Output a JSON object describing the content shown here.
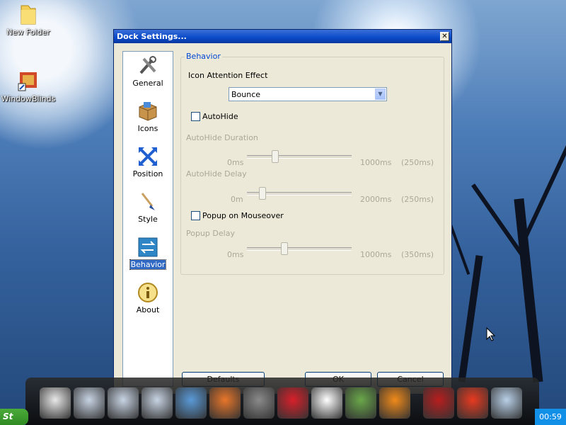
{
  "desktop": {
    "icons": [
      {
        "label": "New Folder",
        "icon": "folder-icon"
      },
      {
        "label": "WindowBlinds",
        "icon": "windowblinds-icon"
      }
    ]
  },
  "dialog": {
    "title": "Dock Settings...",
    "nav": [
      {
        "label": "General",
        "icon": "tools-icon",
        "selected": false
      },
      {
        "label": "Icons",
        "icon": "box-icon",
        "selected": false
      },
      {
        "label": "Position",
        "icon": "arrows-icon",
        "selected": false
      },
      {
        "label": "Style",
        "icon": "brush-icon",
        "selected": false
      },
      {
        "label": "Behavior",
        "icon": "behavior-icon",
        "selected": true
      },
      {
        "label": "About",
        "icon": "info-icon",
        "selected": false
      }
    ],
    "group_title": "Behavior",
    "attention_label": "Icon Attention Effect",
    "attention_value": "Bounce",
    "autohide_label": "AutoHide",
    "autohide_checked": false,
    "autohide_duration": {
      "label": "AutoHide Duration",
      "min": "0ms",
      "max": "1000ms",
      "value": "(250ms)",
      "fraction": 0.25
    },
    "autohide_delay": {
      "label": "AutoHide Delay",
      "min": "0m",
      "max": "2000ms",
      "value": "(250ms)",
      "fraction": 0.125
    },
    "popup_label": "Popup on Mouseover",
    "popup_checked": false,
    "popup_delay": {
      "label": "Popup Delay",
      "min": "0ms",
      "max": "1000ms",
      "value": "(350ms)",
      "fraction": 0.35
    },
    "buttons": {
      "defaults": "Defaults",
      "ok": "OK",
      "cancel": "Cancel"
    }
  },
  "dock": {
    "items": [
      "presentation-icon",
      "folder-icon",
      "folder-icon",
      "folder-icon",
      "messenger-icon",
      "firefox-icon",
      "controller-icon",
      "opera-icon",
      "yandex-icon",
      "photo-icon",
      "vlc-icon",
      "flash-icon",
      "p-icon",
      "recycle-bin-icon"
    ]
  },
  "taskbar": {
    "start": "St",
    "clock": "00:59"
  },
  "colors": {
    "accent": "#316ac5",
    "title": "#0a49c8",
    "disabled": "#aca899"
  }
}
